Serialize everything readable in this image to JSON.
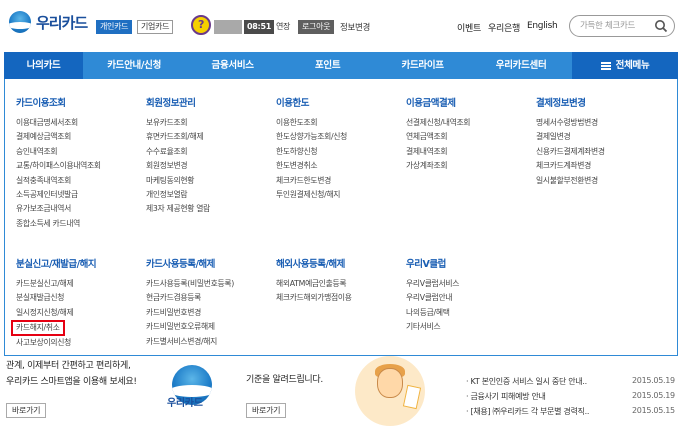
{
  "header": {
    "logo_text": "우리카드",
    "tab_personal": "개인카드",
    "tab_corporate": "기업카드",
    "help_icon": "?",
    "timer": "08:51",
    "extend": "연장",
    "logout": "로그아웃",
    "info_change": "정보변경",
    "links": [
      "이벤트",
      "우리은행",
      "English"
    ],
    "search_placeholder": "가득한 체크카드"
  },
  "nav": {
    "items": [
      "나의카드",
      "카드안내/신청",
      "금융서비스",
      "포인트",
      "카드라이프",
      "우리카드센터"
    ],
    "all_menu": "전체메뉴"
  },
  "mega": {
    "row1": [
      {
        "title": "카드이용조회",
        "items": [
          "이용대금명세서조회",
          "결제예상금액조회",
          "승인내역조회",
          "교통/하이패스이용내역조회",
          "실적충족내역조회",
          "소득공제인터넷발급",
          "유가보조금내역서",
          "종합소득세 카드내역"
        ]
      },
      {
        "title": "회원정보관리",
        "items": [
          "보유카드조회",
          "휴면카드조회/해제",
          "수수료율조회",
          "회원정보변경",
          "마케팅동의현황",
          "개인정보열람",
          "제3자 제공현황 열람"
        ]
      },
      {
        "title": "이용한도",
        "items": [
          "이용한도조회",
          "한도상향가능조회/신청",
          "한도하향신청",
          "한도변경취소",
          "체크카드한도변경",
          "투인원결제신청/해지"
        ]
      },
      {
        "title": "이용금액결제",
        "items": [
          "선결제신청/내역조회",
          "연체금액조회",
          "결제내역조회",
          "가상계좌조회"
        ]
      },
      {
        "title": "결제정보변경",
        "items": [
          "명세서수령방법변경",
          "결제일변경",
          "신용카드결제계좌변경",
          "체크카드계좌변경",
          "일시불할부전환변경"
        ]
      }
    ],
    "row2": [
      {
        "title": "분실신고/재발급/해지",
        "items": [
          "카드분실신고/해제",
          "분실재발급신청",
          "일시정지신청/해제",
          "카드해지/취소",
          "사고보상이의신청"
        ]
      },
      {
        "title": "카드사용등록/해제",
        "items": [
          "카드사용등록(비밀번호등록)",
          "현금카드겸용등록",
          "카드비밀번호변경",
          "카드비밀번호오류해제",
          "카드별서비스변경/해지"
        ]
      },
      {
        "title": "해외사용등록/해제",
        "items": [
          "해외ATM예금인출등록",
          "체크카드해외가맹점이용"
        ]
      },
      {
        "title": "우리V클럽",
        "items": [
          "우리V클럽서비스",
          "우리V클럽안내",
          "나의등급/혜택",
          "기타서비스"
        ]
      }
    ]
  },
  "behind": {
    "left_line1": "관계, 이제부터 간편하고 편리하게,",
    "left_line2": "우리카드 스마트앱을 이용해 보세요!",
    "go1": "바로가기",
    "wc_name": "우리카드",
    "mid_line": "기준을 알려드립니다.",
    "go2": "바로가기",
    "news": [
      {
        "title": "KT 본인인증 서비스 일시 중단 안내..",
        "date": "2015.05.19"
      },
      {
        "title": "금융사기 피해예방 안내",
        "date": "2015.05.19"
      },
      {
        "title": "[채용] ㈜우리카드 각 부문별 경력직..",
        "date": "2015.05.15"
      }
    ]
  }
}
